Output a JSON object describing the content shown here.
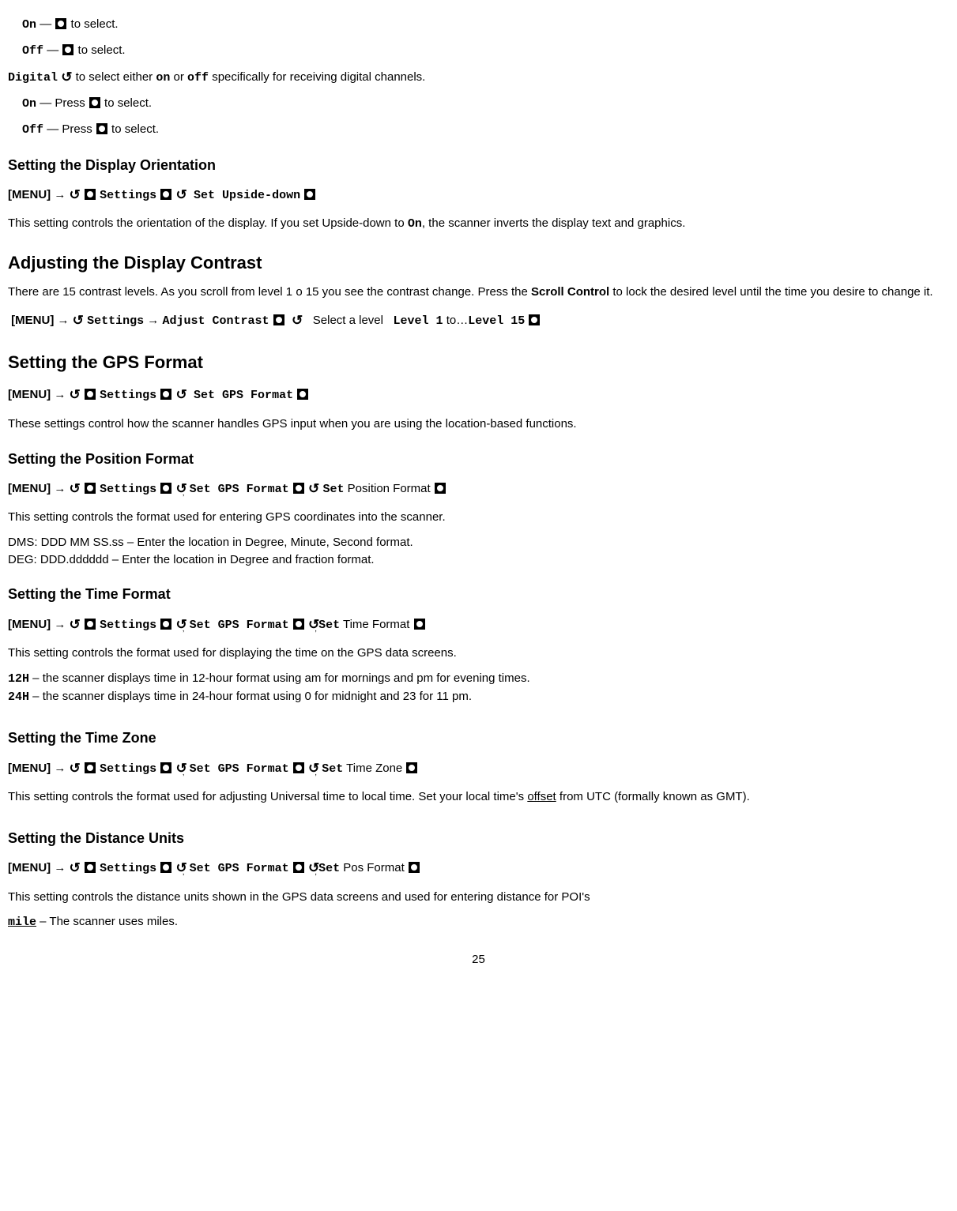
{
  "top": {
    "on": "On",
    "on_rest": " — ",
    "on_after": " to select.",
    "off": "Off",
    "off_rest": " — ",
    "off_after": " to select."
  },
  "digital": {
    "label": "Digital",
    "text1": " to select either ",
    "on": "on",
    "text2": " or ",
    "off": "off",
    "text3": " specifically for receiving digital channels.",
    "sub_on": "On",
    "sub_on_text": " — Press ",
    "sub_on_after": " to select.",
    "sub_off": "Off",
    "sub_off_text": " — Press ",
    "sub_off_after": " to select."
  },
  "sdo": {
    "heading": "Setting the Display Orientation",
    "menu": "[MENU]",
    "settings": "Settings",
    "set_upside": "Set Upside-down",
    "desc_a": "This setting controls the orientation of the display. If you set Upside-down to ",
    "on": "On",
    "desc_b": ", the scanner inverts the display text and graphics."
  },
  "adc": {
    "heading": "Adjusting the Display Contrast",
    "desc_a": "There are 15 contrast levels. As you scroll from level 1 o 15 you see the contrast change. Press the ",
    "scroll_control": "Scroll Control",
    "desc_b": " to lock the desired level until the time you desire to change it.",
    "menu": "[MENU]",
    "settings": "Settings",
    "adjust": "Adjust Contrast",
    "select_level": "Select a level",
    "lvl1": "Level 1",
    "to": " to…",
    "lvl15": "Level 15"
  },
  "gps": {
    "heading": "Setting the GPS Format",
    "menu": "[MENU]",
    "settings": "Settings",
    "set_gps": "Set GPS Format",
    "desc": "These settings control how the scanner handles GPS input when you are using the location-based functions."
  },
  "pos": {
    "heading": "Setting the Position Format",
    "menu": "[MENU]",
    "settings": "Settings",
    "set_gps": "Set GPS Format",
    "set": "Set",
    "posfmt": " Position Format ",
    "desc": "This setting controls the format used for entering GPS coordinates into the scanner.",
    "dms": "DMS: DDD MM SS.ss – Enter the location in Degree, Minute, Second format.",
    "deg": "DEG: DDD.dddddd – Enter the location in Degree and fraction format."
  },
  "time": {
    "heading": "Setting the Time Format",
    "menu": "[MENU]",
    "settings": "Settings",
    "set_gps": "Set GPS Format",
    "set": "Set",
    "timefmt": " Time Format ",
    "desc": "This setting controls the format used for displaying the time on the GPS data screens.",
    "h12": "12H",
    "h12_desc": " – the scanner displays time in 12-hour format using am for mornings and pm for evening times.",
    "h24": "24H",
    "h24_desc": " – the scanner displays time in 24-hour format using 0 for midnight and 23 for 11 pm."
  },
  "tz": {
    "heading": "Setting the Time Zone",
    "menu": "[MENU]",
    "settings": "Settings",
    "set_gps": "Set GPS Format",
    "set": "Set",
    "tz_label": " Time Zone ",
    "desc_a": "This setting controls the format used for adjusting Universal time to local time. Set your local time's ",
    "offset": "offset",
    "desc_b": " from UTC (formally known as GMT)."
  },
  "dist": {
    "heading": "Setting the Distance Units",
    "menu": "[MENU]",
    "settings": "Settings",
    "set_gps": "Set GPS Format",
    "set": "Set",
    "posfmt": " Pos Format ",
    "desc": "This setting controls the distance units shown in the GPS data screens and used for entering distance for POI's",
    "mile": "mile",
    "mile_desc": " – The scanner uses miles."
  },
  "page": "25",
  "glyphs": {
    "arrow": "→"
  }
}
